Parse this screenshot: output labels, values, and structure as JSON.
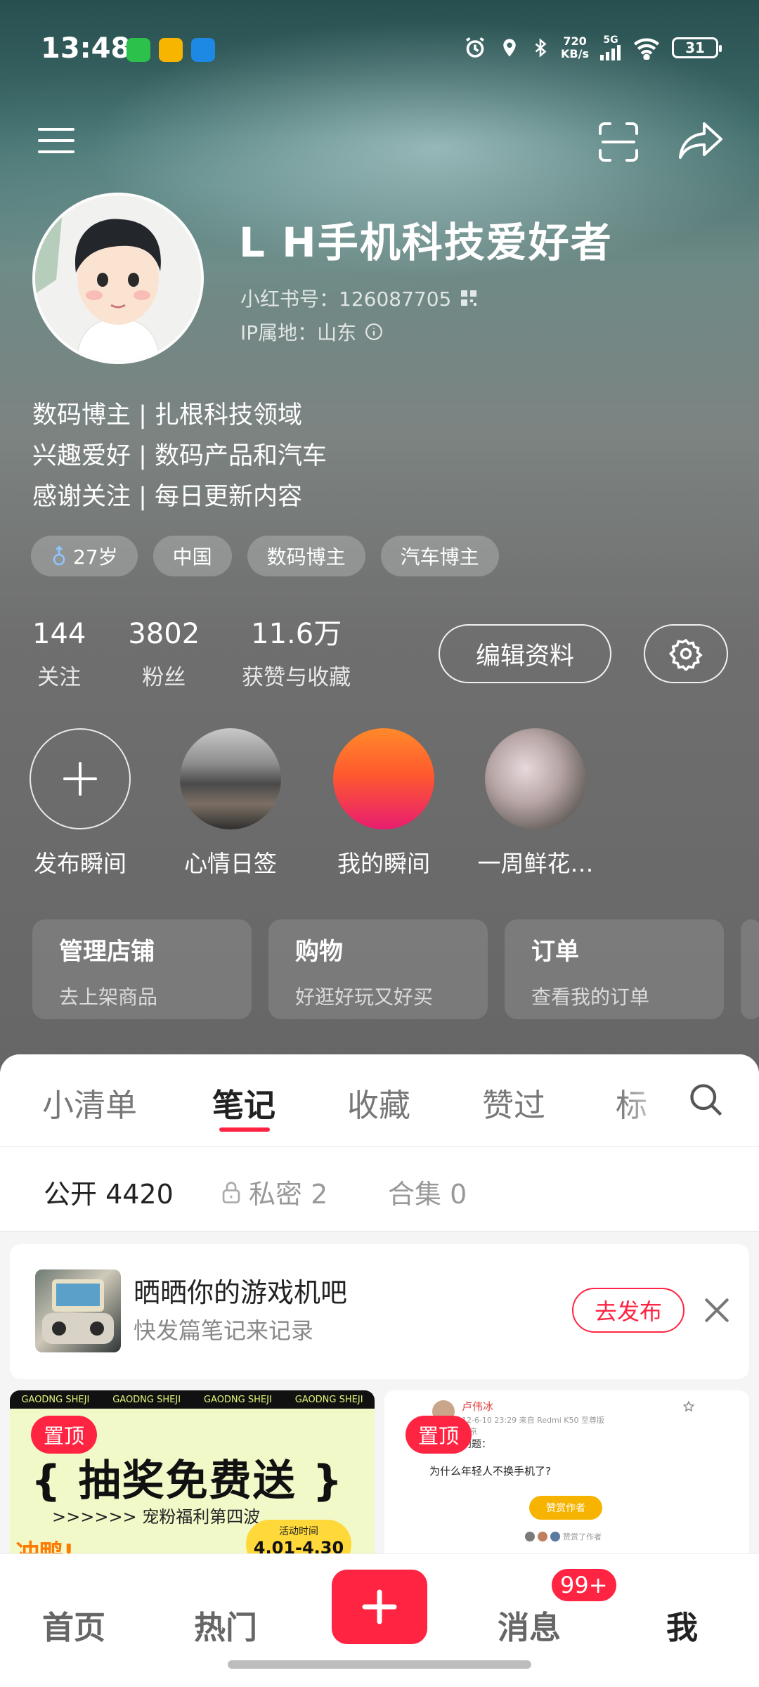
{
  "status_bar": {
    "time": "13:48",
    "net_speed_value": "720",
    "net_speed_unit": "KB/s",
    "signal": "5G",
    "battery": "31"
  },
  "profile": {
    "nickname": "L H手机科技爱好者",
    "id_label": "小红书号：126087705",
    "ip_label": "IP属地：山东",
    "bio": [
      "数码博主 | 扎根科技领域",
      "兴趣爱好 | 数码产品和汽车",
      "感谢关注 | 每日更新内容"
    ],
    "tags": [
      {
        "label": "27岁",
        "icon": "male-icon"
      },
      {
        "label": "中国"
      },
      {
        "label": "数码博主"
      },
      {
        "label": "汽车博主"
      }
    ],
    "stats": [
      {
        "value": "144",
        "label": "关注"
      },
      {
        "value": "3802",
        "label": "粉丝"
      },
      {
        "value": "11.6万",
        "label": "获赞与收藏"
      }
    ],
    "edit_label": "编辑资料"
  },
  "moments": [
    {
      "label": "发布瞬间"
    },
    {
      "label": "心情日签"
    },
    {
      "label": "我的瞬间"
    },
    {
      "label": "一周鲜花…"
    }
  ],
  "shop_cards": [
    {
      "title": "管理店铺",
      "subtitle": "去上架商品"
    },
    {
      "title": "购物",
      "subtitle": "好逛好玩又好买"
    },
    {
      "title": "订单",
      "subtitle": "查看我的订单"
    }
  ],
  "content_tabs": [
    "小清单",
    "笔记",
    "收藏",
    "赞过",
    "标"
  ],
  "active_tab": "笔记",
  "sub_tabs": [
    {
      "label": "公开 4420"
    },
    {
      "label": "私密 2"
    },
    {
      "label": "合集 0"
    }
  ],
  "promo": {
    "title": "晒晒你的游戏机吧",
    "subtitle": "快发篇笔记来记录",
    "action": "去发布"
  },
  "feed": [
    {
      "pin": "置顶",
      "banner_text": "GAODNG SHEJI",
      "headline": "抽奖免费送",
      "subline": ">>>>>> 宠粉福利第四波",
      "side_text": "冲鸭!",
      "date_label": "活动时间",
      "date_range": "4.01-4.30"
    },
    {
      "pin": "置顶",
      "author": "卢伟冰",
      "source": "来自 Redmi K50 至尊版",
      "date": "12-6-10 23:29",
      "location": "北京",
      "question_label": "问题：",
      "question": "为什么年轻人不换手机了?",
      "reward_label": "赞赏作者",
      "rewarded_label": "赞赏了作者"
    }
  ],
  "bottom_nav": {
    "home": "首页",
    "hot": "热门",
    "messages": "消息",
    "me": "我",
    "badge": "99+"
  },
  "colors": {
    "accent": "#ff2442",
    "text_primary": "#222222",
    "text_secondary": "#888888"
  }
}
